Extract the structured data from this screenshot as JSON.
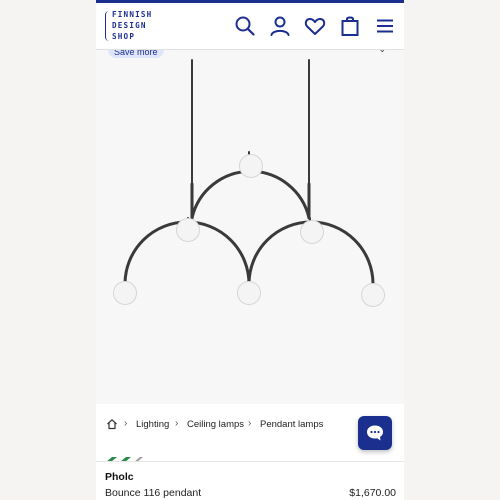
{
  "header": {
    "logo_lines": [
      "FINNISH",
      "DESIGN",
      "SHOP"
    ],
    "icons": [
      "search-icon",
      "account-icon",
      "wishlist-icon",
      "bag-icon",
      "menu-icon"
    ]
  },
  "product_area": {
    "badge_label": "Save more"
  },
  "breadcrumb": {
    "items": [
      "Lighting",
      "Ceiling lamps",
      "Pendant lamps"
    ],
    "separator": "›"
  },
  "product": {
    "brand": "Pholc",
    "name": "Bounce 116 pendant",
    "price": "$1,670.00"
  },
  "colors": {
    "accent": "#1b2f8f",
    "lamp_frame": "#3a3a3a",
    "globe": "#f4f4f4"
  }
}
